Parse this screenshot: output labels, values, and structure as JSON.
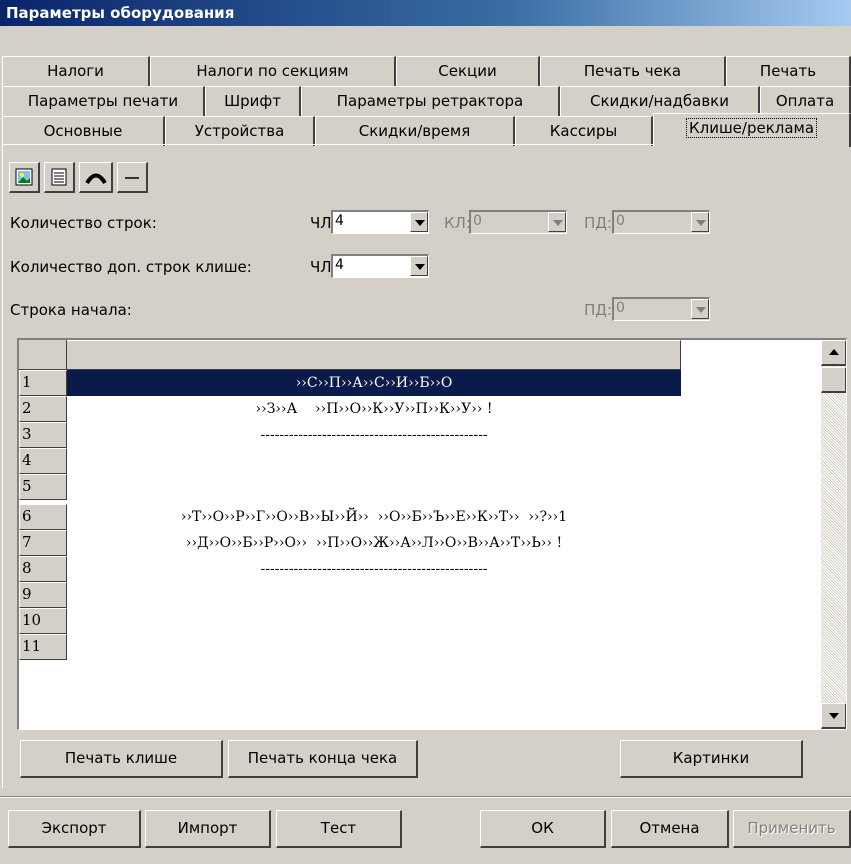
{
  "window": {
    "title": "Параметры оборудования"
  },
  "tabs_row1": [
    "Налоги",
    "Налоги по секциям",
    "Секции",
    "Печать чека",
    "Печать"
  ],
  "tabs_row2": [
    "Параметры печати",
    "Шрифт",
    "Параметры ретрактора",
    "Скидки/надбавки",
    "Оплата"
  ],
  "tabs_row3": [
    "Основные",
    "Устройства",
    "Скидки/время",
    "Кассиры",
    "Клише/реклама"
  ],
  "active_tab": "Клише/реклама",
  "form": {
    "row_count_label": "Количество строк:",
    "extra_rows_label": "Количество доп. строк клише:",
    "start_row_label": "Строка начала:",
    "chl_label": "ЧЛ:",
    "kl_label": "КЛ:",
    "pd_label": "ПД:",
    "row_count_chl": "4",
    "row_count_kl": "0",
    "row_count_pd": "0",
    "extra_rows_chl": "4",
    "start_row_pd": "0"
  },
  "grid": {
    "rows": [
      {
        "n": "1",
        "text": "››С››П››А››С››И››Б››О",
        "selected": true
      },
      {
        "n": "2",
        "text": "››З››А    ››П››О››К››У››П››К››У›› !"
      },
      {
        "n": "3",
        "text": "------------------------------------------------"
      },
      {
        "n": "4",
        "text": ""
      },
      {
        "n": "5",
        "text": ""
      },
      {
        "n": "6",
        "text": "››Т››О››Р››Г››О››В››Ы››Й››  ››О››Б››Ъ››Е››К››Т››  ››?››1"
      },
      {
        "n": "7",
        "text": "››Д››О››Б››Р››О››  ››П››О››Ж››А››Л››О››В››А››Т››Ь›› !"
      },
      {
        "n": "8",
        "text": "------------------------------------------------"
      },
      {
        "n": "9",
        "text": ""
      },
      {
        "n": "10",
        "text": ""
      },
      {
        "n": "11",
        "text": ""
      }
    ]
  },
  "buttons": {
    "print_cliche": "Печать клише",
    "print_end": "Печать конца чека",
    "pictures": "Картинки",
    "export": "Экспорт",
    "import": "Импорт",
    "test": "Тест",
    "ok": "ОК",
    "cancel": "Отмена",
    "apply": "Применить"
  },
  "icons": [
    "picture-icon",
    "text-align-icon",
    "arc-text-icon",
    "line-icon"
  ]
}
